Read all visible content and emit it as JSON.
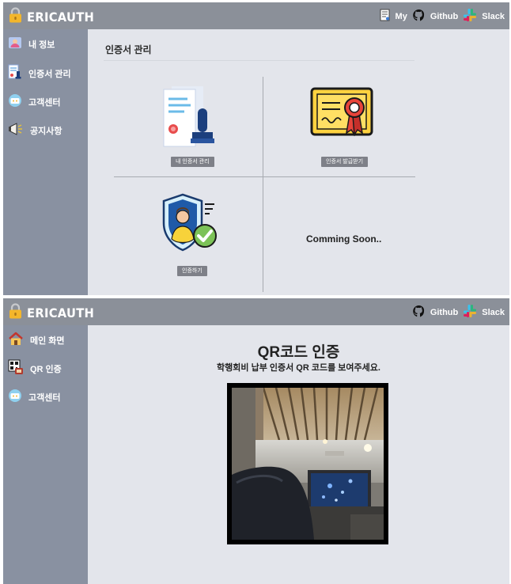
{
  "screen1": {
    "app_title": "ERICAUTH",
    "nav": {
      "my": "My",
      "github": "Github",
      "slack": "Slack"
    },
    "sidebar": [
      {
        "label": "내 정보",
        "icon": "profile-card-icon"
      },
      {
        "label": "인증서 관리",
        "icon": "certificate-doc-icon"
      },
      {
        "label": "고객센터",
        "icon": "customer-service-icon"
      },
      {
        "label": "공지사항",
        "icon": "megaphone-icon"
      }
    ],
    "page_title": "인증서 관리",
    "cards": {
      "my_cert": "내 인증서 관리",
      "issue_cert": "인증서 발급받기",
      "authenticate": "인증하기",
      "coming_soon": "Comming Soon.."
    }
  },
  "screen2": {
    "app_title": "ERICAUTH",
    "nav": {
      "github": "Github",
      "slack": "Slack"
    },
    "sidebar": [
      {
        "label": "메인 화면",
        "icon": "home-icon"
      },
      {
        "label": "QR 인증",
        "icon": "qr-scan-icon"
      },
      {
        "label": "고객센터",
        "icon": "customer-service-icon"
      }
    ],
    "title": "QR코드 인증",
    "subtitle": "학행회비 납부 인증서 QR 코드를 보여주세요."
  }
}
